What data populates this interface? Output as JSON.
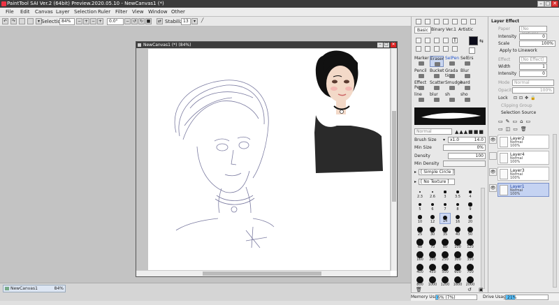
{
  "window": {
    "title": "PaintTool SAI Ver.2 (64bit) Preview.2020.05.10 - NewCanvas1 (*)",
    "minimize": "–",
    "maximize": "□",
    "close": "✕"
  },
  "menu": [
    "File",
    "Edit",
    "Canvas",
    "Layer",
    "Selection",
    "Ruler",
    "Filter",
    "View",
    "Window",
    "Other"
  ],
  "toolbar": {
    "selection_label": "Selection",
    "zoom": "84%",
    "angle": "0.0°",
    "stabilizer_label": "Stabilizer",
    "stabilizer_value": "13"
  },
  "canvas_window": {
    "title": "NewCanvas1 (*) (84%)",
    "minimize": "–",
    "maximize": "□",
    "close": "✕"
  },
  "navigator": {
    "name": "NewCanvas1",
    "zoom": "84%"
  },
  "tool_panel": {
    "tabs": [
      "Basic",
      "Binary",
      "Ver.1",
      "Artistic"
    ],
    "tools": [
      {
        "label": "Marker"
      },
      {
        "label": "Eraser"
      },
      {
        "label": "SelPen"
      },
      {
        "label": "SelErs"
      },
      {
        "label": "Pencil"
      },
      {
        "label": "Bucket"
      },
      {
        "label": "Grada tion"
      },
      {
        "label": "Blur"
      },
      {
        "label": "Effect Pen"
      },
      {
        "label": "Scatter"
      },
      {
        "label": "Smudge"
      },
      {
        "label": "hard"
      },
      {
        "label": "line"
      },
      {
        "label": "blur"
      },
      {
        "label": "sh"
      },
      {
        "label": "sho"
      }
    ],
    "blend_mode": "Normal",
    "brush_size_label": "Brush Size",
    "brush_size_mult": "x1.0",
    "brush_size_value": "14.0",
    "min_size_label": "Min Size",
    "min_size_value": "0%",
    "density_label": "Density",
    "density_value": "100",
    "min_density_label": "Min Density",
    "simple_circle": "[ Simple Circle ]",
    "no_texture": "[ No Texture ]",
    "sizes": [
      "2.3",
      "2.6",
      "3",
      "3.5",
      "4",
      "5",
      "6",
      "7",
      "8",
      "9",
      "10",
      "12",
      "14",
      "16",
      "20",
      "25",
      "30",
      "35",
      "40",
      "50",
      "60",
      "70",
      "80",
      "100",
      "120",
      "160",
      "200",
      "250",
      "300",
      "350",
      "400",
      "450",
      "500",
      "600",
      "700",
      "800",
      "1000",
      "1200",
      "1600",
      "2000"
    ],
    "selected_size": "14"
  },
  "layer_panel": {
    "layer_effect_label": "Layer Effect",
    "paper_label": "Paper",
    "paper_value": "[No Texture]",
    "intensity_label": "Intensity",
    "intensity_value": "0",
    "scale_label": "Scale",
    "scale_value": "100%",
    "apply_linework": "Apply to Linework",
    "effect_label": "Effect",
    "effect_value": "[No Effect]",
    "width_label": "Width",
    "width_value": "1",
    "intensity2_value": "0",
    "mode_label": "Mode",
    "mode_value": "Normal",
    "opacity_label": "Opacity",
    "opacity_value": "100%",
    "lock_label": "Lock",
    "clipping_group": "Clipping Group",
    "selection_source": "Selection Source",
    "layers": [
      {
        "name": "Layer2",
        "mode": "Normal",
        "opacity": "100%"
      },
      {
        "name": "Layer4",
        "mode": "Normal",
        "opacity": "100%"
      },
      {
        "name": "Layer3",
        "mode": "Normal",
        "opacity": "100%"
      },
      {
        "name": "Layer1",
        "mode": "Normal",
        "opacity": "100%"
      }
    ]
  },
  "status": {
    "memory_label": "Memory Usage",
    "memory_value": "6% (7%)",
    "memory_fraction": 0.06,
    "drive_label": "Drive Usage",
    "drive_value": "21%",
    "drive_fraction": 0.21
  }
}
